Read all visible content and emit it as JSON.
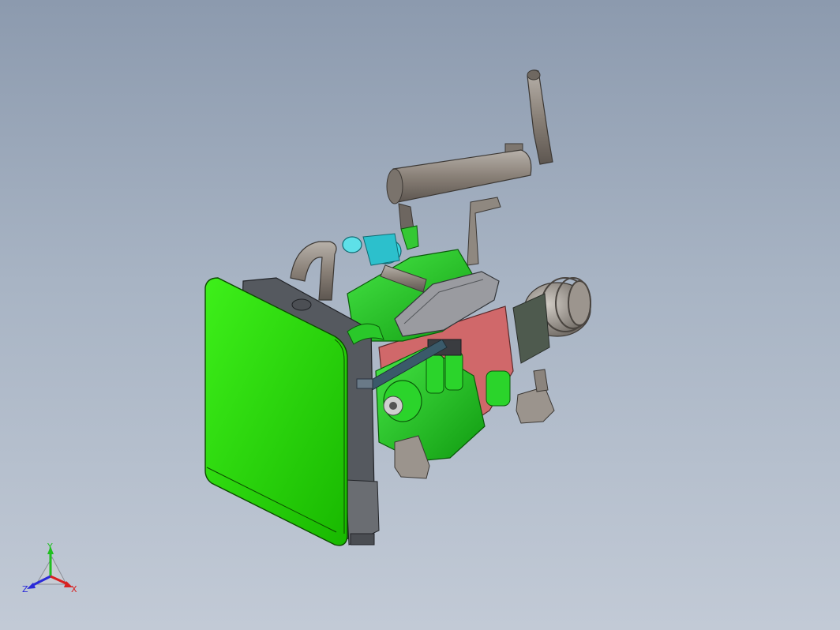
{
  "viewport": {
    "background_top": "#8c9aae",
    "background_bottom": "#c2cad6"
  },
  "model": {
    "colors": {
      "radiator": "#22d400",
      "engine_green": "#1ec81e",
      "exhaust_gray": "#8a8178",
      "turbo_cyan": "#3ad6e0",
      "block_red": "#d0686a",
      "dark_gray": "#5a5f66"
    }
  },
  "triad": {
    "y_label": "Y",
    "z_label": "Z",
    "x_label": "X",
    "colors": {
      "y": "#1fbf1f",
      "z": "#2a2ad8",
      "x": "#d82020"
    }
  }
}
